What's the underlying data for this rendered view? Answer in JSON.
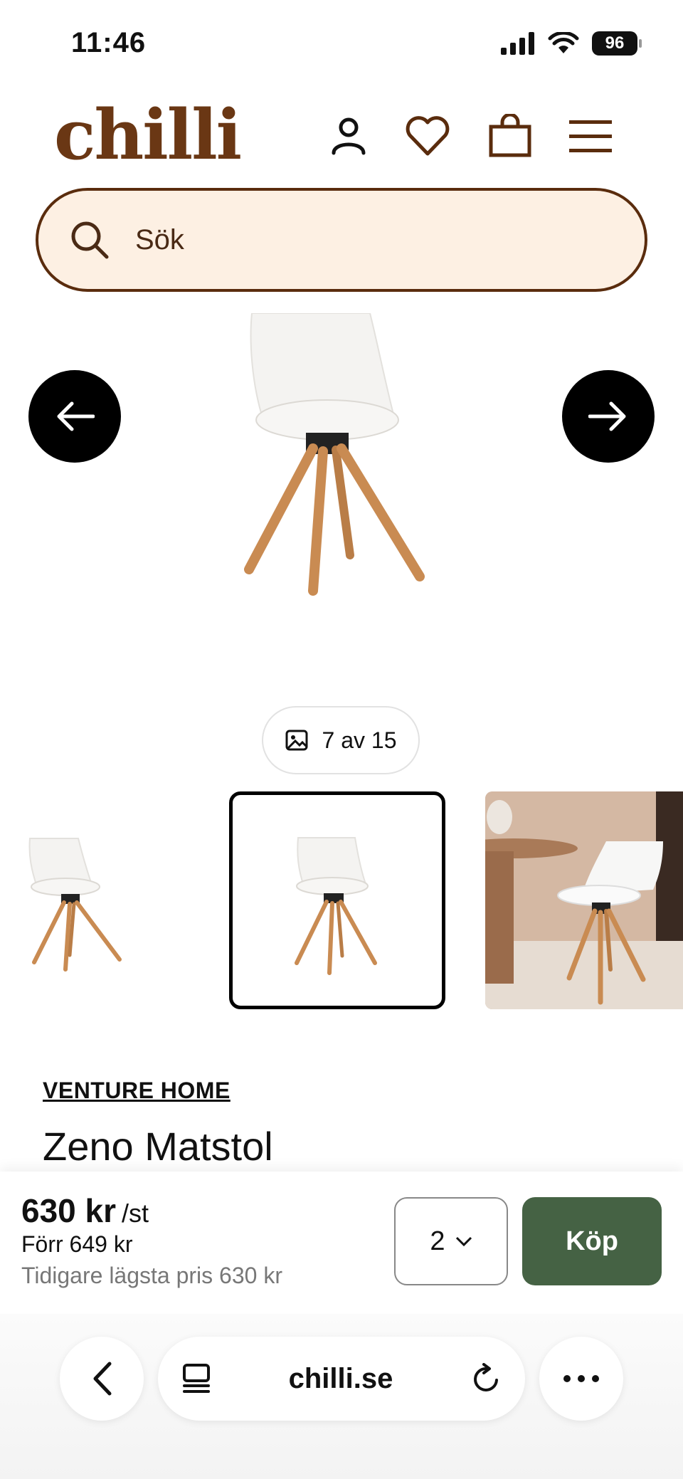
{
  "status_bar": {
    "time": "11:46",
    "battery": "96"
  },
  "header": {
    "logo": "chilli"
  },
  "search": {
    "placeholder": "Sök"
  },
  "gallery": {
    "counter": "7 av 15"
  },
  "product": {
    "brand": "VENTURE HOME",
    "title": "Zeno Matstol",
    "price": "630 kr",
    "price_unit": "/st",
    "previous_price": "Förr 649 kr",
    "lowest_price": "Tidigare lägsta pris 630 kr",
    "quantity": "2",
    "buy_label": "Köp"
  },
  "browser": {
    "url": "chilli.se"
  },
  "colors": {
    "brand": "#6a3714",
    "search_bg": "#fdf0e3",
    "buy": "#456244"
  }
}
